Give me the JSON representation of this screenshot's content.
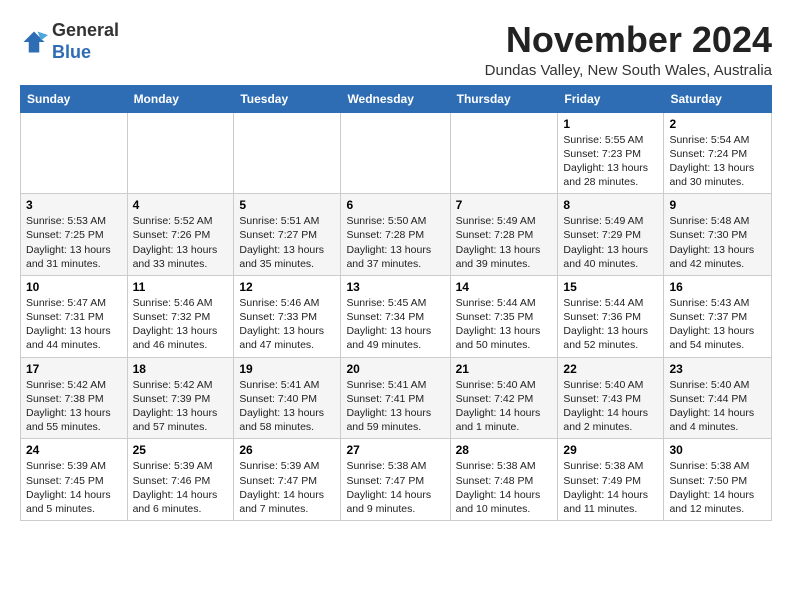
{
  "logo": {
    "general": "General",
    "blue": "Blue"
  },
  "header": {
    "month": "November 2024",
    "location": "Dundas Valley, New South Wales, Australia"
  },
  "weekdays": [
    "Sunday",
    "Monday",
    "Tuesday",
    "Wednesday",
    "Thursday",
    "Friday",
    "Saturday"
  ],
  "weeks": [
    [
      {
        "day": "",
        "info": ""
      },
      {
        "day": "",
        "info": ""
      },
      {
        "day": "",
        "info": ""
      },
      {
        "day": "",
        "info": ""
      },
      {
        "day": "",
        "info": ""
      },
      {
        "day": "1",
        "info": "Sunrise: 5:55 AM\nSunset: 7:23 PM\nDaylight: 13 hours and 28 minutes."
      },
      {
        "day": "2",
        "info": "Sunrise: 5:54 AM\nSunset: 7:24 PM\nDaylight: 13 hours and 30 minutes."
      }
    ],
    [
      {
        "day": "3",
        "info": "Sunrise: 5:53 AM\nSunset: 7:25 PM\nDaylight: 13 hours and 31 minutes."
      },
      {
        "day": "4",
        "info": "Sunrise: 5:52 AM\nSunset: 7:26 PM\nDaylight: 13 hours and 33 minutes."
      },
      {
        "day": "5",
        "info": "Sunrise: 5:51 AM\nSunset: 7:27 PM\nDaylight: 13 hours and 35 minutes."
      },
      {
        "day": "6",
        "info": "Sunrise: 5:50 AM\nSunset: 7:28 PM\nDaylight: 13 hours and 37 minutes."
      },
      {
        "day": "7",
        "info": "Sunrise: 5:49 AM\nSunset: 7:28 PM\nDaylight: 13 hours and 39 minutes."
      },
      {
        "day": "8",
        "info": "Sunrise: 5:49 AM\nSunset: 7:29 PM\nDaylight: 13 hours and 40 minutes."
      },
      {
        "day": "9",
        "info": "Sunrise: 5:48 AM\nSunset: 7:30 PM\nDaylight: 13 hours and 42 minutes."
      }
    ],
    [
      {
        "day": "10",
        "info": "Sunrise: 5:47 AM\nSunset: 7:31 PM\nDaylight: 13 hours and 44 minutes."
      },
      {
        "day": "11",
        "info": "Sunrise: 5:46 AM\nSunset: 7:32 PM\nDaylight: 13 hours and 46 minutes."
      },
      {
        "day": "12",
        "info": "Sunrise: 5:46 AM\nSunset: 7:33 PM\nDaylight: 13 hours and 47 minutes."
      },
      {
        "day": "13",
        "info": "Sunrise: 5:45 AM\nSunset: 7:34 PM\nDaylight: 13 hours and 49 minutes."
      },
      {
        "day": "14",
        "info": "Sunrise: 5:44 AM\nSunset: 7:35 PM\nDaylight: 13 hours and 50 minutes."
      },
      {
        "day": "15",
        "info": "Sunrise: 5:44 AM\nSunset: 7:36 PM\nDaylight: 13 hours and 52 minutes."
      },
      {
        "day": "16",
        "info": "Sunrise: 5:43 AM\nSunset: 7:37 PM\nDaylight: 13 hours and 54 minutes."
      }
    ],
    [
      {
        "day": "17",
        "info": "Sunrise: 5:42 AM\nSunset: 7:38 PM\nDaylight: 13 hours and 55 minutes."
      },
      {
        "day": "18",
        "info": "Sunrise: 5:42 AM\nSunset: 7:39 PM\nDaylight: 13 hours and 57 minutes."
      },
      {
        "day": "19",
        "info": "Sunrise: 5:41 AM\nSunset: 7:40 PM\nDaylight: 13 hours and 58 minutes."
      },
      {
        "day": "20",
        "info": "Sunrise: 5:41 AM\nSunset: 7:41 PM\nDaylight: 13 hours and 59 minutes."
      },
      {
        "day": "21",
        "info": "Sunrise: 5:40 AM\nSunset: 7:42 PM\nDaylight: 14 hours and 1 minute."
      },
      {
        "day": "22",
        "info": "Sunrise: 5:40 AM\nSunset: 7:43 PM\nDaylight: 14 hours and 2 minutes."
      },
      {
        "day": "23",
        "info": "Sunrise: 5:40 AM\nSunset: 7:44 PM\nDaylight: 14 hours and 4 minutes."
      }
    ],
    [
      {
        "day": "24",
        "info": "Sunrise: 5:39 AM\nSunset: 7:45 PM\nDaylight: 14 hours and 5 minutes."
      },
      {
        "day": "25",
        "info": "Sunrise: 5:39 AM\nSunset: 7:46 PM\nDaylight: 14 hours and 6 minutes."
      },
      {
        "day": "26",
        "info": "Sunrise: 5:39 AM\nSunset: 7:47 PM\nDaylight: 14 hours and 7 minutes."
      },
      {
        "day": "27",
        "info": "Sunrise: 5:38 AM\nSunset: 7:47 PM\nDaylight: 14 hours and 9 minutes."
      },
      {
        "day": "28",
        "info": "Sunrise: 5:38 AM\nSunset: 7:48 PM\nDaylight: 14 hours and 10 minutes."
      },
      {
        "day": "29",
        "info": "Sunrise: 5:38 AM\nSunset: 7:49 PM\nDaylight: 14 hours and 11 minutes."
      },
      {
        "day": "30",
        "info": "Sunrise: 5:38 AM\nSunset: 7:50 PM\nDaylight: 14 hours and 12 minutes."
      }
    ]
  ]
}
